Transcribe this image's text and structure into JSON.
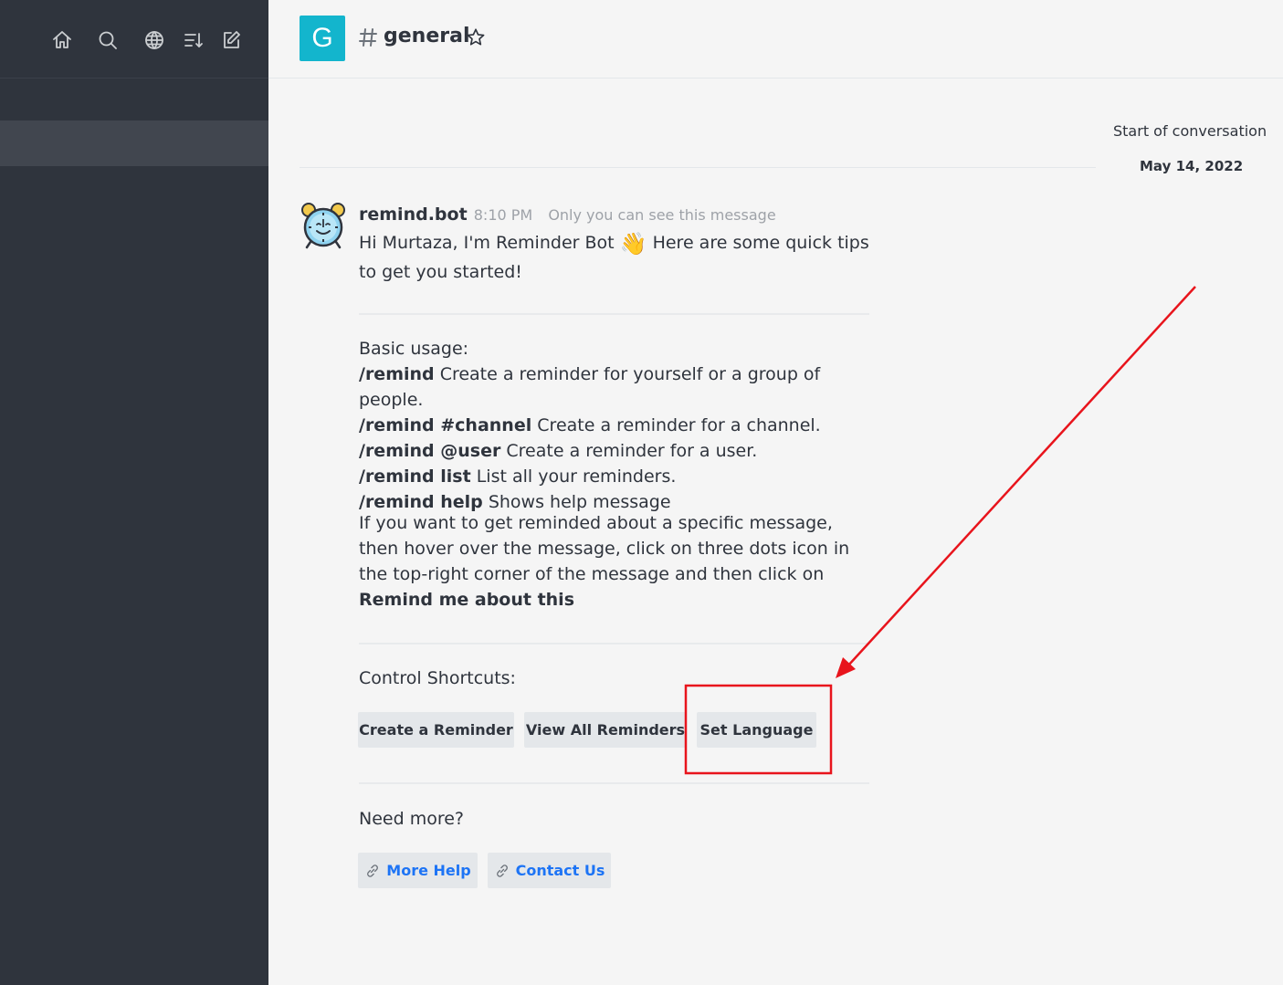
{
  "sidebar": {
    "icons": [
      "home-icon",
      "search-icon",
      "directory-icon",
      "sort-icon",
      "create-new-icon"
    ]
  },
  "header": {
    "avatar_letter": "G",
    "room_name": "general",
    "avatar_color": "#13b5cd"
  },
  "conversation": {
    "start_label": "Start of conversation",
    "date": "May 14, 2022"
  },
  "message": {
    "username": "remind.bot",
    "time": "8:10 PM",
    "private_note": "Only you can see this message",
    "greeting_part1": "Hi Murtaza, I'm Reminder Bot",
    "wave_emoji": "👋",
    "greeting_part2": "Here are some quick tips to get you started!",
    "usage_title": "Basic usage:",
    "commands": [
      {
        "cmd": "/remind",
        "desc": "Create a reminder for yourself or a group of people."
      },
      {
        "cmd": "/remind #channel",
        "desc": "Create a reminder for a channel."
      },
      {
        "cmd": "/remind @user",
        "desc": "Create a reminder for a user."
      },
      {
        "cmd": "/remind list",
        "desc": "List all your reminders."
      },
      {
        "cmd": "/remind help",
        "desc": "Shows help message"
      }
    ],
    "help_text": "If you want to get reminded about a specific message, then hover over the message, click on three dots icon in the top-right corner of the message and then click on",
    "help_bold": "Remind me about this",
    "shortcuts_label": "Control Shortcuts:",
    "buttons": {
      "create": "Create a Reminder",
      "view_all": "View All Reminders",
      "set_language": "Set Language"
    },
    "need_more_label": "Need more?",
    "links": {
      "more_help": "More Help",
      "contact_us": "Contact Us"
    }
  },
  "colors": {
    "sidebar_bg": "#2f343d",
    "link": "#1d74f5",
    "annotation": "#e8141c"
  }
}
